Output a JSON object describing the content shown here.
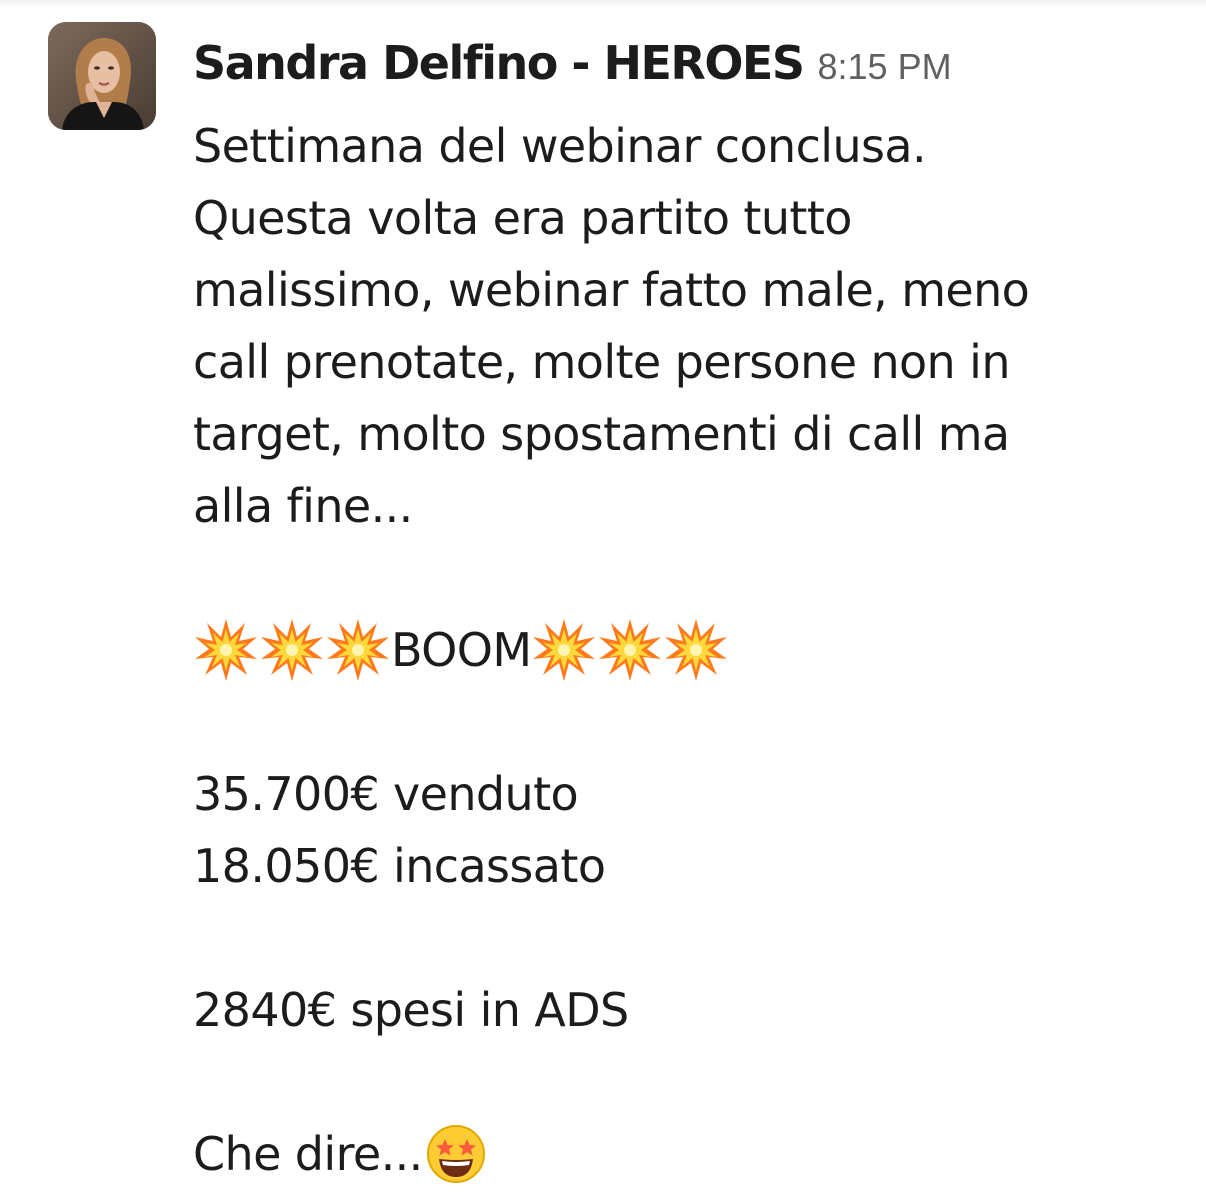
{
  "message": {
    "author": "Sandra Delfino - HEROES",
    "timestamp": "8:15 PM",
    "avatar_icon": "user-photo-avatar",
    "paragraph_1": [
      "Settimana del webinar conclusa.",
      "Questa volta era partito tutto",
      "malissimo, webinar fatto male, meno",
      "call prenotate, molte persone non in",
      "target, molto spostamenti di call ma",
      "alla fine..."
    ],
    "boom": {
      "emoji_icon": "collision-emoji",
      "text": "BOOM"
    },
    "sales": [
      "35.700€ venduto",
      "18.050€ incassato"
    ],
    "ads": "2840€ spesi in ADS",
    "closing": {
      "text": "Che dire...",
      "emoji_icon": "star-struck-emoji"
    }
  },
  "colors": {
    "text": "#1d1c1d",
    "timestamp": "#616061",
    "background": "#ffffff"
  }
}
